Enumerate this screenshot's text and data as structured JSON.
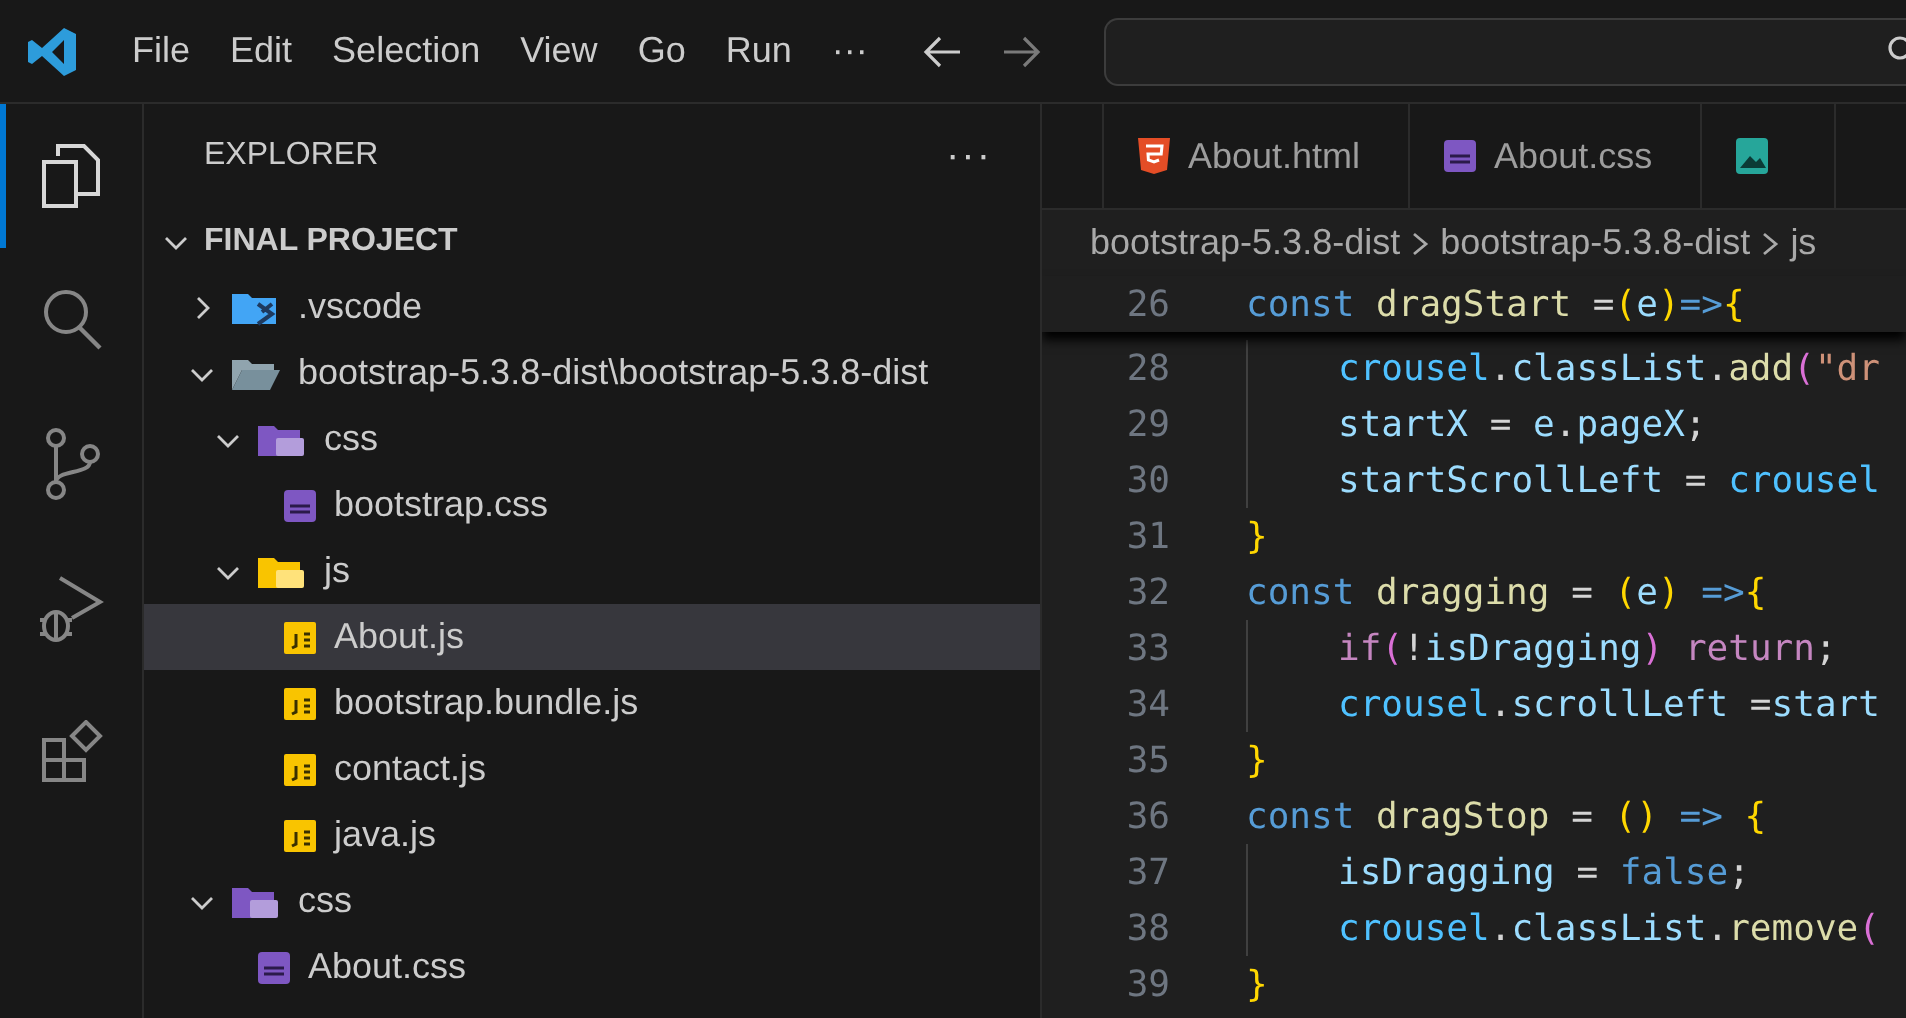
{
  "menu": [
    {
      "label": "File"
    },
    {
      "label": "Edit"
    },
    {
      "label": "Selection"
    },
    {
      "label": "View"
    },
    {
      "label": "Go"
    },
    {
      "label": "Run"
    },
    {
      "label": "···"
    }
  ],
  "activity_bar": [
    {
      "kind": "explorer",
      "selected": true
    },
    {
      "kind": "search",
      "selected": false
    },
    {
      "kind": "source-control",
      "selected": false
    },
    {
      "kind": "run-debug",
      "selected": false
    },
    {
      "kind": "extensions",
      "selected": false
    }
  ],
  "sidebar": {
    "title": "EXPLORER",
    "more": "···",
    "folder": {
      "title": "FINAL PROJECT",
      "expanded": true,
      "children": [
        {
          "label": ".vscode",
          "kind": "vscode-folder",
          "expanded": false,
          "selected": false
        },
        {
          "label": "bootstrap-5.3.8-dist\\bootstrap-5.3.8-dist",
          "kind": "folder",
          "expanded": true,
          "selected": false,
          "children": [
            {
              "label": "css",
              "kind": "css-folder",
              "expanded": true,
              "selected": false,
              "children": [
                {
                  "label": "bootstrap.css",
                  "kind": "css",
                  "selected": false
                }
              ]
            },
            {
              "label": "js",
              "kind": "js-folder",
              "expanded": true,
              "selected": false,
              "children": [
                {
                  "label": "About.js",
                  "kind": "js",
                  "selected": true
                },
                {
                  "label": "bootstrap.bundle.js",
                  "kind": "js",
                  "selected": false
                },
                {
                  "label": "contact.js",
                  "kind": "js",
                  "selected": false
                },
                {
                  "label": "java.js",
                  "kind": "js",
                  "selected": false
                }
              ]
            }
          ]
        },
        {
          "label": "css",
          "kind": "css-folder",
          "expanded": true,
          "selected": false,
          "children": [
            {
              "label": "About.css",
              "kind": "css",
              "selected": false
            }
          ]
        }
      ]
    }
  },
  "tabs": [
    {
      "label": "About.html",
      "kind": "html"
    },
    {
      "label": "About.css",
      "kind": "css"
    },
    {
      "kind": "image"
    }
  ],
  "breadcrumbs": [
    "bootstrap-5.3.8-dist",
    "bootstrap-5.3.8-dist",
    "js"
  ],
  "code": {
    "sticky": {
      "number": "26",
      "indented": false,
      "tokens": [
        {
          "text": "const ",
          "kind": "keyword"
        },
        {
          "text": "dragStart",
          "kind": "function"
        },
        {
          "text": " =",
          "kind": "plain"
        },
        {
          "text": "(",
          "kind": "bracket"
        },
        {
          "text": "e",
          "kind": "variable"
        },
        {
          "text": ")",
          "kind": "bracket"
        },
        {
          "text": "=>",
          "kind": "keyword"
        },
        {
          "text": "{",
          "kind": "bracket"
        }
      ]
    },
    "lines": [
      {
        "number": "28",
        "indented": true,
        "tokens": [
          {
            "text": "crousel",
            "kind": "constant"
          },
          {
            "text": ".",
            "kind": "plain"
          },
          {
            "text": "classList",
            "kind": "variable"
          },
          {
            "text": ".",
            "kind": "plain"
          },
          {
            "text": "add",
            "kind": "function"
          },
          {
            "text": "(",
            "kind": "bracket2"
          },
          {
            "text": "\"dr",
            "kind": "string"
          }
        ]
      },
      {
        "number": "29",
        "indented": true,
        "tokens": [
          {
            "text": "startX",
            "kind": "variable"
          },
          {
            "text": " = ",
            "kind": "plain"
          },
          {
            "text": "e",
            "kind": "variable"
          },
          {
            "text": ".",
            "kind": "plain"
          },
          {
            "text": "pageX",
            "kind": "variable"
          },
          {
            "text": ";",
            "kind": "plain"
          }
        ]
      },
      {
        "number": "30",
        "indented": true,
        "tokens": [
          {
            "text": "startScrollLeft",
            "kind": "variable"
          },
          {
            "text": " = ",
            "kind": "plain"
          },
          {
            "text": "crousel",
            "kind": "constant"
          }
        ]
      },
      {
        "number": "31",
        "indented": false,
        "tokens": [
          {
            "text": "}",
            "kind": "bracket"
          }
        ]
      },
      {
        "number": "32",
        "indented": false,
        "tokens": [
          {
            "text": "const ",
            "kind": "keyword"
          },
          {
            "text": "dragging",
            "kind": "function"
          },
          {
            "text": " = ",
            "kind": "plain"
          },
          {
            "text": "(",
            "kind": "bracket"
          },
          {
            "text": "e",
            "kind": "variable"
          },
          {
            "text": ") ",
            "kind": "bracket"
          },
          {
            "text": "=>",
            "kind": "keyword"
          },
          {
            "text": "{",
            "kind": "bracket"
          }
        ]
      },
      {
        "number": "33",
        "indented": true,
        "tokens": [
          {
            "text": "if",
            "kind": "control"
          },
          {
            "text": "(",
            "kind": "bracket2"
          },
          {
            "text": "!",
            "kind": "plain"
          },
          {
            "text": "isDragging",
            "kind": "variable"
          },
          {
            "text": ") ",
            "kind": "bracket2"
          },
          {
            "text": "return",
            "kind": "control"
          },
          {
            "text": ";",
            "kind": "plain"
          }
        ]
      },
      {
        "number": "34",
        "indented": true,
        "tokens": [
          {
            "text": "crousel",
            "kind": "constant"
          },
          {
            "text": ".",
            "kind": "plain"
          },
          {
            "text": "scrollLeft",
            "kind": "variable"
          },
          {
            "text": " =",
            "kind": "plain"
          },
          {
            "text": "start",
            "kind": "variable"
          }
        ]
      },
      {
        "number": "35",
        "indented": false,
        "tokens": [
          {
            "text": "}",
            "kind": "bracket"
          }
        ]
      },
      {
        "number": "36",
        "indented": false,
        "tokens": [
          {
            "text": "const ",
            "kind": "keyword"
          },
          {
            "text": "dragStop",
            "kind": "function"
          },
          {
            "text": " = ",
            "kind": "plain"
          },
          {
            "text": "() ",
            "kind": "bracket"
          },
          {
            "text": "=> ",
            "kind": "keyword"
          },
          {
            "text": "{",
            "kind": "bracket"
          }
        ]
      },
      {
        "number": "37",
        "indented": true,
        "tokens": [
          {
            "text": "isDragging",
            "kind": "variable"
          },
          {
            "text": " = ",
            "kind": "plain"
          },
          {
            "text": "false",
            "kind": "keyword"
          },
          {
            "text": ";",
            "kind": "plain"
          }
        ]
      },
      {
        "number": "38",
        "indented": true,
        "tokens": [
          {
            "text": "crousel",
            "kind": "constant"
          },
          {
            "text": ".",
            "kind": "plain"
          },
          {
            "text": "classList",
            "kind": "variable"
          },
          {
            "text": ".",
            "kind": "plain"
          },
          {
            "text": "remove",
            "kind": "function"
          },
          {
            "text": "(",
            "kind": "bracket2"
          }
        ]
      },
      {
        "number": "39",
        "indented": false,
        "tokens": [
          {
            "text": "}",
            "kind": "bracket"
          }
        ]
      }
    ]
  }
}
